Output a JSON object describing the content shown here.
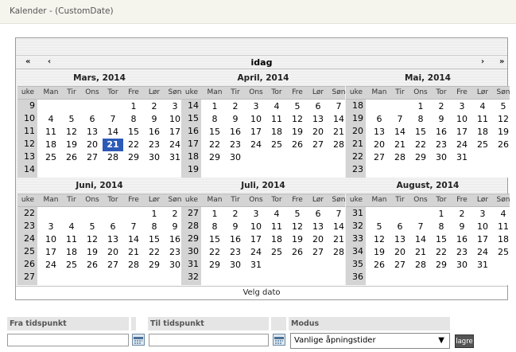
{
  "window": {
    "title": "Kalender - (CustomDate)"
  },
  "calendar": {
    "nav": {
      "prev_year": "«",
      "prev_month": "‹",
      "today": "idag",
      "next_month": "›",
      "next_year": "»"
    },
    "weekday_headers": [
      "uke",
      "Man",
      "Tir",
      "Ons",
      "Tor",
      "Fre",
      "Lør",
      "Søn"
    ],
    "select_date_label": "Velg dato",
    "selected": {
      "month_index": 0,
      "day": 21
    },
    "months": [
      {
        "title": "Mars, 2014",
        "weeks": [
          "9",
          "10",
          "11",
          "12",
          "13",
          "14"
        ],
        "first_weekday": 5,
        "days": 31
      },
      {
        "title": "April, 2014",
        "weeks": [
          "14",
          "15",
          "16",
          "17",
          "18",
          "19"
        ],
        "first_weekday": 1,
        "days": 30
      },
      {
        "title": "Mai, 2014",
        "weeks": [
          "18",
          "19",
          "20",
          "21",
          "22",
          "23"
        ],
        "first_weekday": 3,
        "days": 31
      },
      {
        "title": "Juni, 2014",
        "weeks": [
          "22",
          "23",
          "24",
          "25",
          "26",
          "27"
        ],
        "first_weekday": 6,
        "days": 30
      },
      {
        "title": "Juli, 2014",
        "weeks": [
          "27",
          "28",
          "29",
          "30",
          "31",
          "32"
        ],
        "first_weekday": 1,
        "days": 31
      },
      {
        "title": "August, 2014",
        "weeks": [
          "31",
          "32",
          "33",
          "34",
          "35",
          "36"
        ],
        "first_weekday": 4,
        "days": 31
      }
    ]
  },
  "form": {
    "from_label": "Fra tidspunkt",
    "to_label": "Til tidspunkt",
    "mode_label": "Modus",
    "from_value": "",
    "to_value": "",
    "mode_value": "Vanlige åpningstider",
    "save_label": "lagre"
  }
}
